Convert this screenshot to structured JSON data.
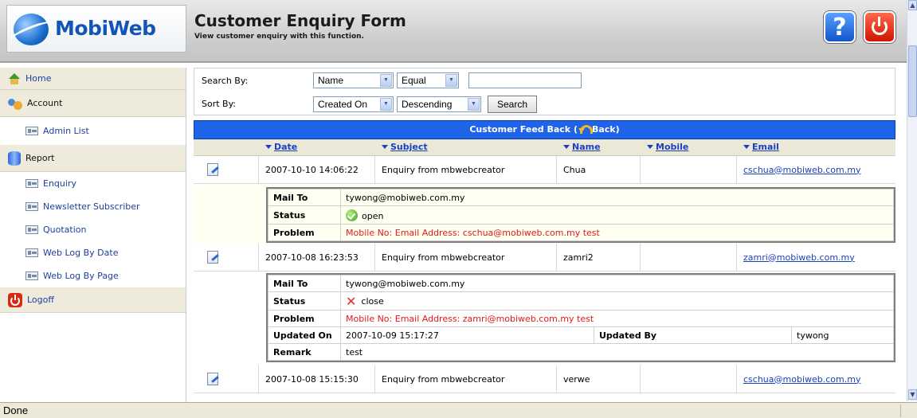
{
  "header": {
    "logo_text": "MobiWeb",
    "title": "Customer Enquiry Form",
    "subtitle": "View customer enquiry with this function.",
    "help_icon": "question-icon",
    "power_icon": "power-icon"
  },
  "sidebar": {
    "items": [
      {
        "label": "Home",
        "icon": "home-icon",
        "kind": "head"
      },
      {
        "label": "Account",
        "icon": "users-icon",
        "kind": "head"
      },
      {
        "label": "Admin List",
        "icon": "list-icon",
        "kind": "sub"
      },
      {
        "label": "Report",
        "icon": "database-icon",
        "kind": "head"
      },
      {
        "label": "Enquiry",
        "icon": "list-icon",
        "kind": "sub"
      },
      {
        "label": "Newsletter Subscriber",
        "icon": "list-icon",
        "kind": "sub"
      },
      {
        "label": "Quotation",
        "icon": "list-icon",
        "kind": "sub"
      },
      {
        "label": "Web Log By Date",
        "icon": "list-icon",
        "kind": "sub"
      },
      {
        "label": "Web Log By Page",
        "icon": "list-icon",
        "kind": "sub"
      },
      {
        "label": "Logoff",
        "icon": "power-icon",
        "kind": "head"
      }
    ]
  },
  "search": {
    "search_by_label": "Search By:",
    "sort_by_label": "Sort By:",
    "field_value": "Name",
    "operator_value": "Equal",
    "keyword_value": "",
    "sort_field_value": "Created On",
    "sort_order_value": "Descending",
    "search_button": "Search"
  },
  "results": {
    "banner_title": "Customer Feed Back (",
    "banner_back": "Back)",
    "columns": [
      "Date",
      "Subject",
      "Name",
      "Mobile",
      "Email"
    ],
    "records": [
      {
        "date": "2007-10-10 14:06:22",
        "subject": "Enquiry from mbwebcreator",
        "name": "Chua",
        "mobile": "",
        "email": "cschua@mobiweb.com.my",
        "detail": {
          "mail_to_label": "Mail To",
          "mail_to": "tywong@mobiweb.com.my",
          "status_label": "Status",
          "status": "open",
          "problem_label": "Problem",
          "problem": "Mobile No: Email Address: cschua@mobiweb.com.my test"
        }
      },
      {
        "date": "2007-10-08 16:23:53",
        "subject": "Enquiry from mbwebcreator",
        "name": "zamri2",
        "mobile": "",
        "email": "zamri@mobiweb.com.my",
        "detail": {
          "mail_to_label": "Mail To",
          "mail_to": "tywong@mobiweb.com.my",
          "status_label": "Status",
          "status": "close",
          "problem_label": "Problem",
          "problem": "Mobile No: Email Address: zamri@mobiweb.com.my test",
          "updated_on_label": "Updated On",
          "updated_on": "2007-10-09 15:17:27",
          "updated_by_label": "Updated By",
          "updated_by": "tywong",
          "remark_label": "Remark",
          "remark": "test"
        }
      },
      {
        "date": "2007-10-08 15:15:30",
        "subject": "Enquiry from mbwebcreator",
        "name": "verwe",
        "mobile": "",
        "email": "cschua@mobiweb.com.my"
      }
    ]
  },
  "statusbar": {
    "text": "Done"
  },
  "colors": {
    "banner": "#1f63e8",
    "error_text": "#e01a1a",
    "link": "#1b3fbf",
    "nav_bg": "#eeeadc"
  }
}
